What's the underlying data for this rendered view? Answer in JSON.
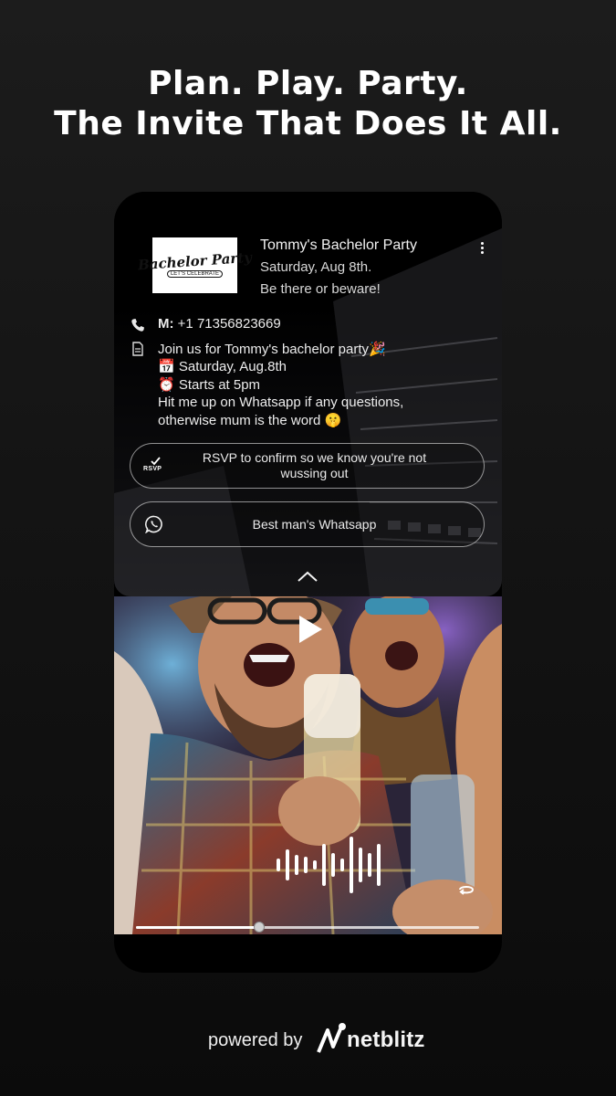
{
  "headline": {
    "line1": "Plan. Play. Party.",
    "line2": "The Invite That Does It All."
  },
  "invite": {
    "logo_text": "Bachelor Party",
    "logo_subtext": "LET'S CELEBRATE",
    "title": "Tommy's Bachelor Party",
    "date_line": "Saturday, Aug 8th.",
    "tagline": "Be there or beware!",
    "phone_label": "M:",
    "phone_number": "+1 71356823669",
    "description_lines": [
      "Join us for Tommy's bachelor party🎉",
      "📅 Saturday, Aug.8th",
      "⏰ Starts at 5pm",
      "Hit me up on Whatsapp if any questions,",
      "otherwise mum is the word 🤫"
    ],
    "rsvp_icon_text": "RSVP",
    "rsvp_button": "RSVP to confirm so we know you're not wussing out",
    "whatsapp_button": "Best man's Whatsapp"
  },
  "player": {
    "progress": 0.36
  },
  "footer": {
    "powered_by": "powered by",
    "brand": "netblitz"
  },
  "icons": {
    "phone": "phone-icon",
    "document": "document-icon",
    "rsvp": "rsvp-check-icon",
    "whatsapp": "whatsapp-icon",
    "more": "more-vertical-icon",
    "collapse": "chevron-up-icon",
    "play": "play-icon",
    "audio": "audio-wave-icon",
    "loop": "loop-icon"
  },
  "colors": {
    "background": "#141414",
    "card": "#000000",
    "text": "#ffffff"
  }
}
